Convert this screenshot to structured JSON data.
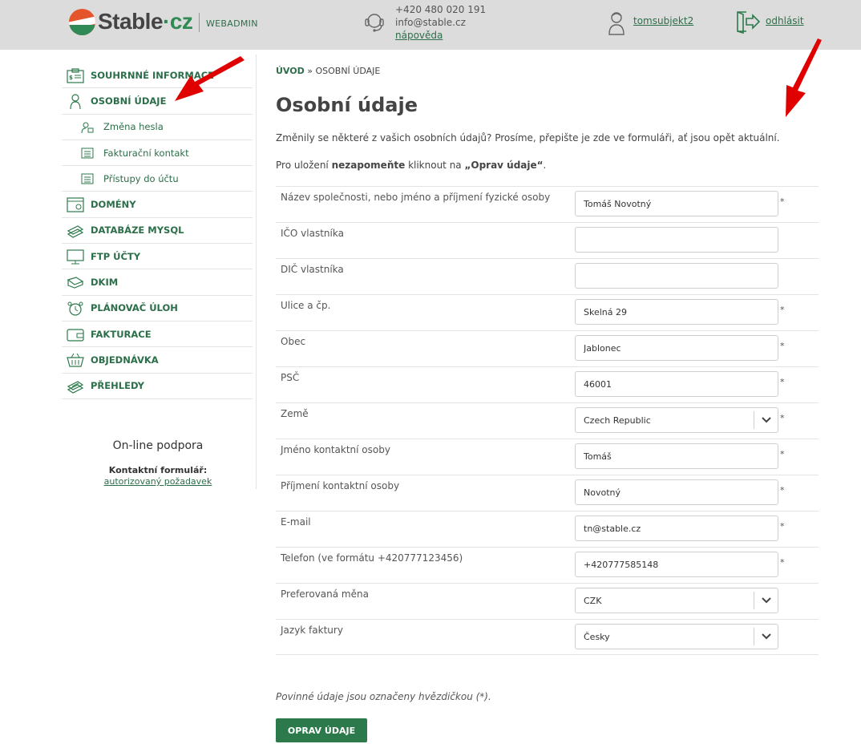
{
  "header": {
    "logo_text": "Stable",
    "logo_suffix": "·cz",
    "product": "WEBADMIN",
    "phone": "+420 480 020 191",
    "email": "info@stable.cz",
    "help": "nápověda",
    "username": "tomsubjekt2",
    "logout": "odhlásit"
  },
  "sidebar": {
    "items": [
      {
        "label": "SOUHRNNÉ INFORMACE",
        "icon": "summary-card-icon"
      },
      {
        "label": "OSOBNÍ ÚDAJE",
        "icon": "person-icon"
      },
      {
        "label": "DOMÉNY",
        "icon": "browser-window-icon"
      },
      {
        "label": "DATABÁZE MYSQL",
        "icon": "database-stack-icon"
      },
      {
        "label": "FTP ÚČTY",
        "icon": "ftp-monitor-icon"
      },
      {
        "label": "DKIM",
        "icon": "envelope-key-icon"
      },
      {
        "label": "PLÁNOVAČ ÚLOH",
        "icon": "alarm-clock-icon"
      },
      {
        "label": "FAKTURACE",
        "icon": "wallet-icon"
      },
      {
        "label": "OBJEDNÁVKA",
        "icon": "basket-icon"
      },
      {
        "label": "PŘEHLEDY",
        "icon": "reports-stack-icon"
      }
    ],
    "subitems": [
      {
        "label": "Změna hesla",
        "icon": "person-lock-icon"
      },
      {
        "label": "Fakturační kontakt",
        "icon": "document-list-icon"
      },
      {
        "label": "Přístupy do účtu",
        "icon": "document-list-icon"
      }
    ],
    "online_title": "On-line podpora",
    "contact_label": "Kontaktní formulář:",
    "contact_link": "autorizovaný požadavek"
  },
  "main": {
    "breadcrumb_home": "ÚVOD",
    "breadcrumb_sep": "»",
    "breadcrumb_current": "OSOBNÍ ÚDAJE",
    "title": "Osobní údaje",
    "intro1": "Změnily se některé z vašich osobních údajů? Prosíme, přepište je zde ve formuláři, ať jsou opět aktuální.",
    "intro2_a": "Pro uložení ",
    "intro2_b": "nezapomeňte",
    "intro2_c": " kliknout na ",
    "intro2_d": "„Oprav údaje“",
    "intro2_e": ".",
    "fields": [
      {
        "label": "Název společnosti, nebo jméno a příjmení fyzické osoby",
        "value": "Tomáš Novotný",
        "required": true,
        "type": "text"
      },
      {
        "label": "IČO vlastníka",
        "value": "",
        "required": false,
        "type": "text"
      },
      {
        "label": "DIČ vlastníka",
        "value": "",
        "required": false,
        "type": "text"
      },
      {
        "label": "Ulice a čp.",
        "value": "Skelná 29",
        "required": true,
        "type": "text"
      },
      {
        "label": "Obec",
        "value": "Jablonec",
        "required": true,
        "type": "text"
      },
      {
        "label": "PSČ",
        "value": "46001",
        "required": true,
        "type": "text"
      },
      {
        "label": "Země",
        "value": "Czech Republic",
        "required": true,
        "type": "select"
      },
      {
        "label": "Jméno kontaktní osoby",
        "value": "Tomáš",
        "required": true,
        "type": "text"
      },
      {
        "label": "Příjmení kontaktní osoby",
        "value": "Novotný",
        "required": true,
        "type": "text"
      },
      {
        "label": "E-mail",
        "value": "tn@stable.cz",
        "required": true,
        "type": "text"
      },
      {
        "label": "Telefon (ve formátu +420777123456)",
        "value": "+420777585148",
        "required": true,
        "type": "text"
      },
      {
        "label": "Preferovaná měna",
        "value": "CZK",
        "required": false,
        "type": "select"
      },
      {
        "label": "Jazyk faktury",
        "value": "Česky",
        "required": false,
        "type": "select"
      }
    ],
    "required_mark": "*",
    "footnote": "Povinné údaje jsou označeny hvězdičkou (*).",
    "submit": "OPRAV ÚDAJE"
  },
  "colors": {
    "accent": "#2c6e49",
    "button": "#2c7a4b",
    "header_bg": "#dcdcdc",
    "annotation_arrow": "#e00000"
  }
}
